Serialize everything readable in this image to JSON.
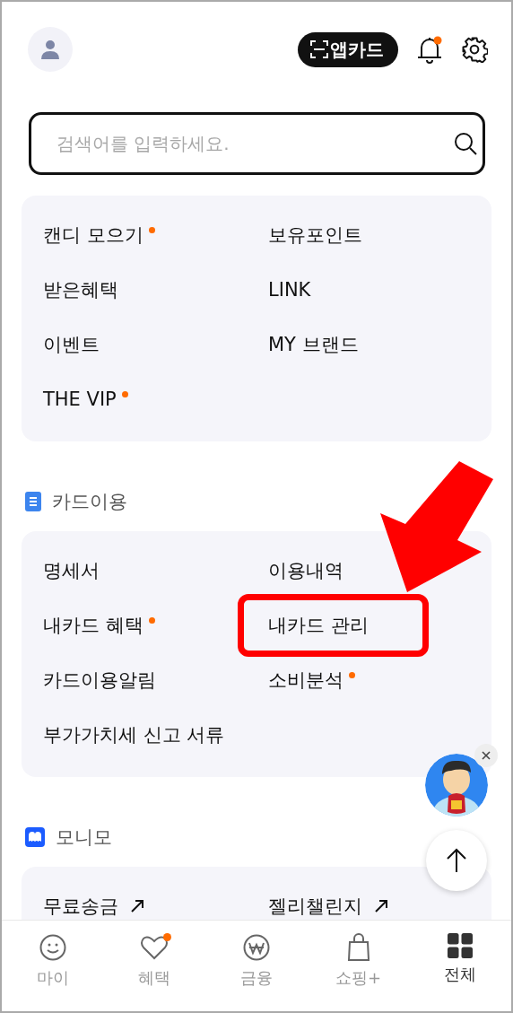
{
  "header": {
    "app_card_button": "앱카드",
    "notification_unread": true
  },
  "search": {
    "placeholder": "검색어를 입력하세요."
  },
  "quick_menu": [
    {
      "label": "캔디 모으기",
      "new_dot": true
    },
    {
      "label": "보유포인트",
      "new_dot": false
    },
    {
      "label": "받은혜택",
      "new_dot": false
    },
    {
      "label": "LINK",
      "new_dot": false
    },
    {
      "label": "이벤트",
      "new_dot": false
    },
    {
      "label": "MY 브랜드",
      "new_dot": false
    },
    {
      "label": "THE VIP",
      "new_dot": true
    }
  ],
  "sections": [
    {
      "title": "카드이용",
      "kind": "document",
      "items": [
        {
          "label": "명세서",
          "new_dot": false,
          "external": false,
          "highlighted": false
        },
        {
          "label": "이용내역",
          "new_dot": false,
          "external": false,
          "highlighted": false
        },
        {
          "label": "내카드 혜택",
          "new_dot": true,
          "external": false,
          "highlighted": false
        },
        {
          "label": "내카드 관리",
          "new_dot": false,
          "external": false,
          "highlighted": true
        },
        {
          "label": "카드이용알림",
          "new_dot": false,
          "external": false,
          "highlighted": false
        },
        {
          "label": "소비분석",
          "new_dot": true,
          "external": false,
          "highlighted": false
        },
        {
          "label": "부가가치세 신고 서류",
          "new_dot": false,
          "external": false,
          "highlighted": false
        }
      ]
    },
    {
      "title": "모니모",
      "kind": "monimo",
      "items": [
        {
          "label": "무료송금",
          "new_dot": false,
          "external": true,
          "highlighted": false
        },
        {
          "label": "젤리챌린지",
          "new_dot": false,
          "external": true,
          "highlighted": false
        }
      ]
    }
  ],
  "bottom_nav": [
    {
      "label": "마이",
      "kind": "smile",
      "selected": false,
      "badge": false
    },
    {
      "label": "혜택",
      "kind": "heart",
      "selected": false,
      "badge": true
    },
    {
      "label": "금융",
      "kind": "won",
      "selected": false,
      "badge": false
    },
    {
      "label": "쇼핑+",
      "kind": "bag",
      "selected": false,
      "badge": false
    },
    {
      "label": "전체",
      "kind": "grid",
      "selected": true,
      "badge": false
    }
  ]
}
